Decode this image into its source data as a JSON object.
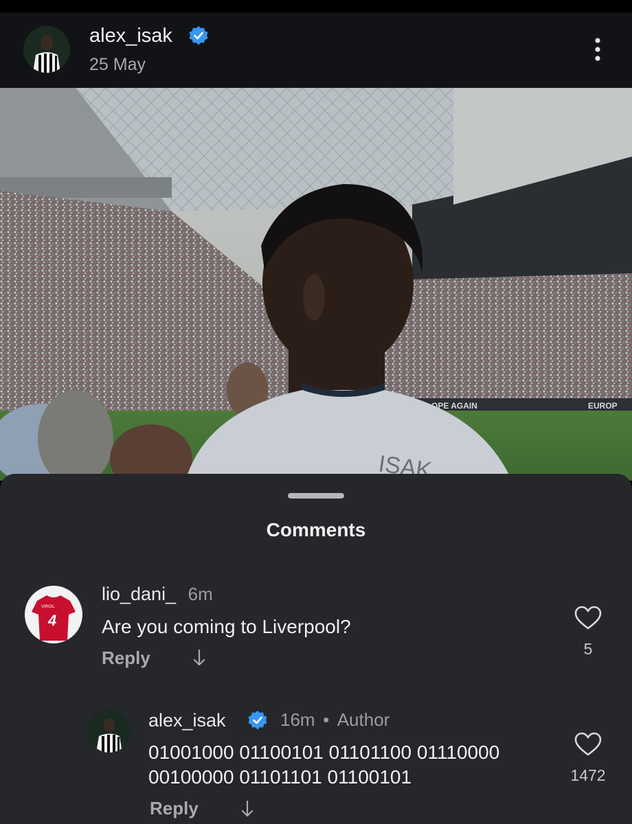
{
  "post": {
    "username": "alex_isak",
    "date": "25 May",
    "verified_icon": "verified-badge-icon",
    "more_icon": "more-vertical-icon"
  },
  "photo": {
    "banner_left": "OPE AGAIN",
    "banner_right": "EUROP",
    "shirt_text": "ISAK"
  },
  "comments_sheet": {
    "title": "Comments",
    "comments": [
      {
        "username": "lio_dani_",
        "time": "6m",
        "text": "Are you coming to Liverpool?",
        "reply_label": "Reply",
        "likes": "5",
        "jersey_number": "4",
        "jersey_name": "VIRGIL"
      },
      {
        "username": "alex_isak",
        "time": "16m",
        "author_label": "Author",
        "text_line1": "01001000 01100101 01101100 01110000",
        "text_line2": "00100000 01101101 01100101",
        "reply_label": "Reply",
        "likes": "1472"
      }
    ]
  },
  "colors": {
    "sheet_bg": "#25272b",
    "header_bg": "#121317",
    "verified_blue": "#3897f0",
    "jersey_red": "#c8102e"
  }
}
